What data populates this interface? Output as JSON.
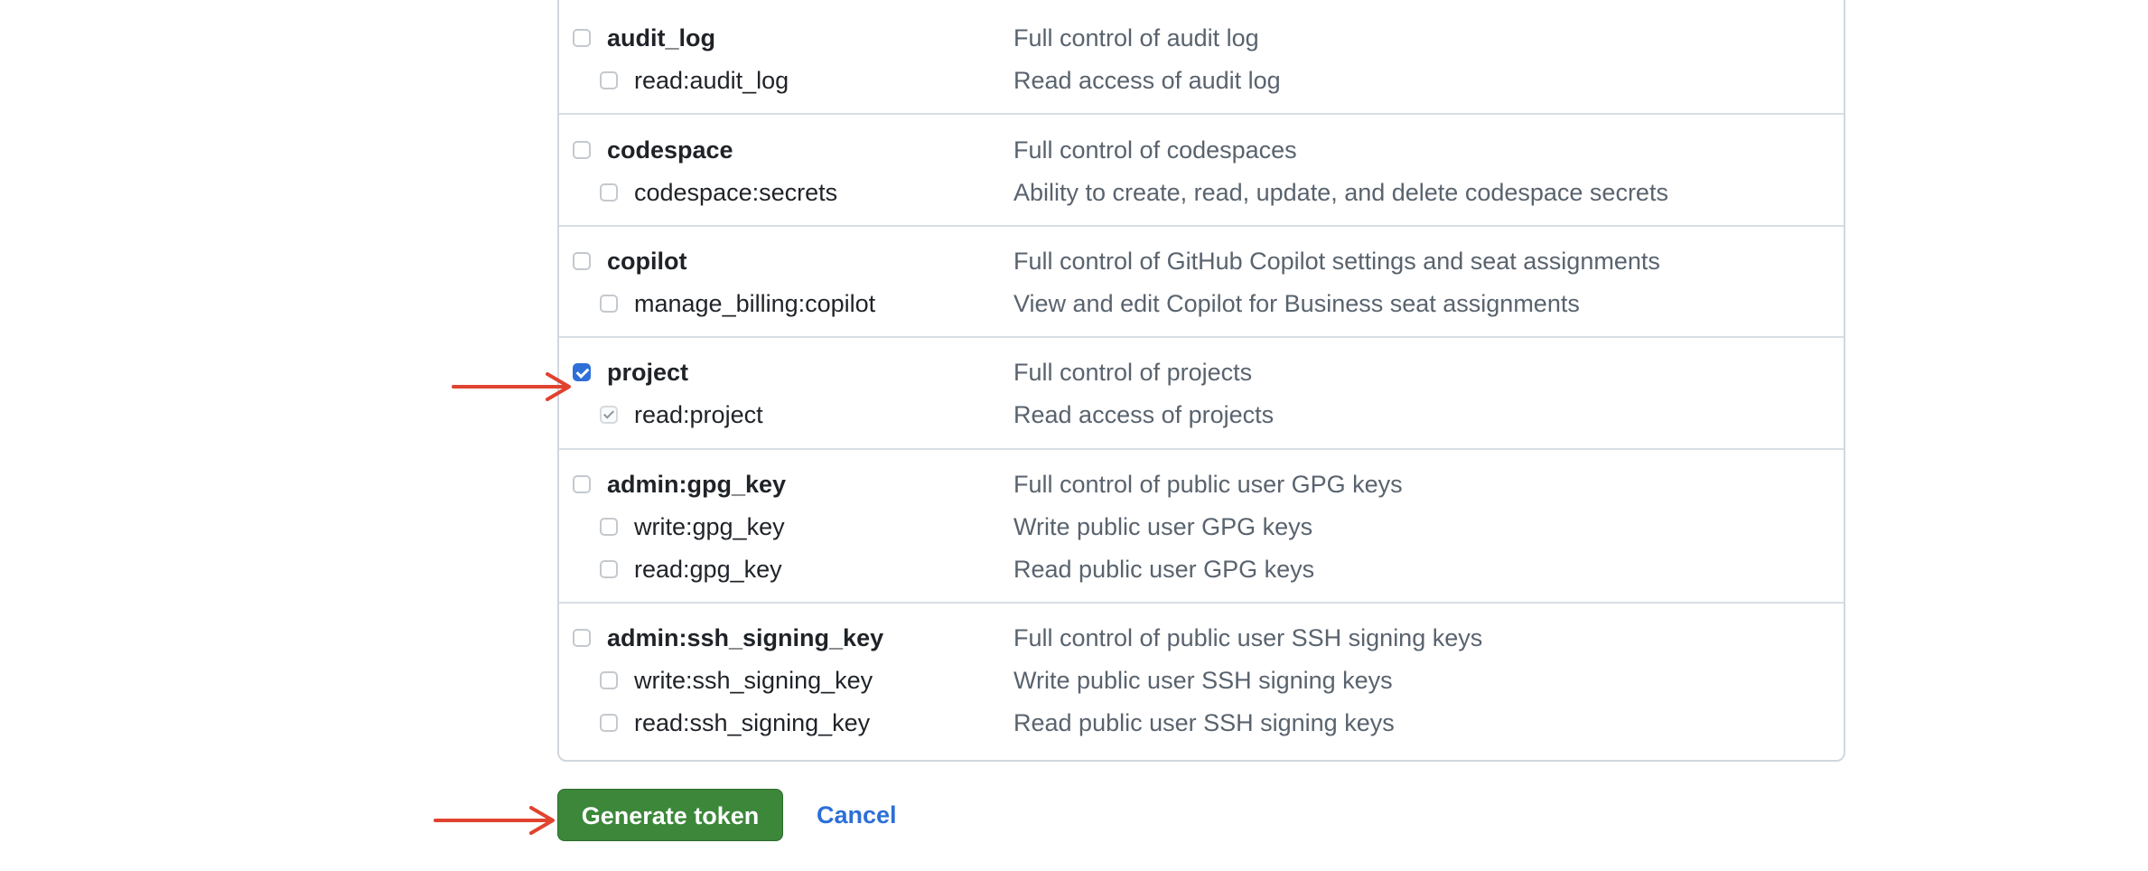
{
  "scope_groups": [
    {
      "parent": {
        "name": "audit_log",
        "description": "Full control of audit log",
        "checked": false
      },
      "children": [
        {
          "name": "read:audit_log",
          "description": "Read access of audit log",
          "state": "unchecked"
        }
      ]
    },
    {
      "parent": {
        "name": "codespace",
        "description": "Full control of codespaces",
        "checked": false
      },
      "children": [
        {
          "name": "codespace:secrets",
          "description": "Ability to create, read, update, and delete codespace secrets",
          "state": "unchecked"
        }
      ]
    },
    {
      "parent": {
        "name": "copilot",
        "description": "Full control of GitHub Copilot settings and seat assignments",
        "checked": false
      },
      "children": [
        {
          "name": "manage_billing:copilot",
          "description": "View and edit Copilot for Business seat assignments",
          "state": "unchecked"
        }
      ]
    },
    {
      "parent": {
        "name": "project",
        "description": "Full control of projects",
        "checked": true
      },
      "children": [
        {
          "name": "read:project",
          "description": "Read access of projects",
          "state": "implied"
        }
      ]
    },
    {
      "parent": {
        "name": "admin:gpg_key",
        "description": "Full control of public user GPG keys",
        "checked": false
      },
      "children": [
        {
          "name": "write:gpg_key",
          "description": "Write public user GPG keys",
          "state": "unchecked"
        },
        {
          "name": "read:gpg_key",
          "description": "Read public user GPG keys",
          "state": "unchecked"
        }
      ]
    },
    {
      "parent": {
        "name": "admin:ssh_signing_key",
        "description": "Full control of public user SSH signing keys",
        "checked": false
      },
      "children": [
        {
          "name": "write:ssh_signing_key",
          "description": "Write public user SSH signing keys",
          "state": "unchecked"
        },
        {
          "name": "read:ssh_signing_key",
          "description": "Read public user SSH signing keys",
          "state": "unchecked"
        }
      ]
    }
  ],
  "actions": {
    "generate_label": "Generate token",
    "cancel_label": "Cancel"
  },
  "colors": {
    "primary_button": "#3c873a",
    "link": "#2d6fd6",
    "checkbox_checked": "#2f6fd8",
    "annotation_arrow": "#e0432f"
  }
}
